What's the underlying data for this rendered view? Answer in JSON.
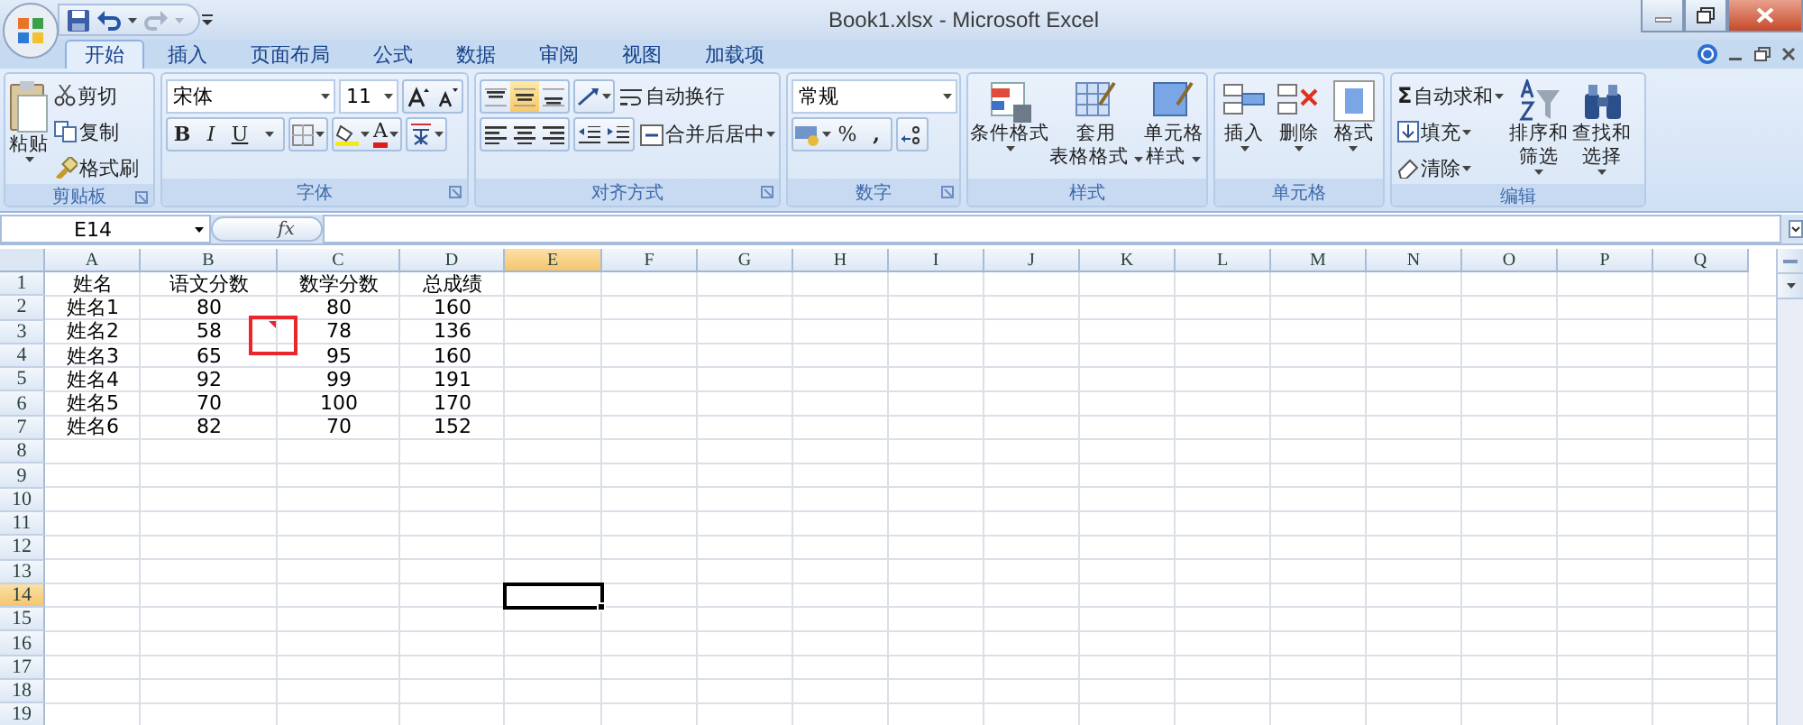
{
  "window": {
    "title": "Book1.xlsx - Microsoft Excel"
  },
  "tabs": [
    {
      "label": "开始",
      "selected": true
    },
    {
      "label": "插入",
      "selected": false
    },
    {
      "label": "页面布局",
      "selected": false
    },
    {
      "label": "公式",
      "selected": false
    },
    {
      "label": "数据",
      "selected": false
    },
    {
      "label": "审阅",
      "selected": false
    },
    {
      "label": "视图",
      "selected": false
    },
    {
      "label": "加载项",
      "selected": false
    }
  ],
  "ribbon": {
    "clipboard": {
      "label": "剪贴板",
      "paste": "粘贴",
      "cut": "剪切",
      "copy": "复制",
      "format_painter": "格式刷"
    },
    "font": {
      "label": "字体",
      "font_name": "宋体",
      "font_size": "11",
      "bold": "B",
      "italic": "I",
      "underline": "U",
      "font_color": "A"
    },
    "alignment": {
      "label": "对齐方式",
      "vertical_align": [
        {
          "selected": false
        },
        {
          "selected": true
        },
        {
          "selected": false
        }
      ],
      "wrap_text": "自动换行",
      "merge_center": "合并后居中"
    },
    "number": {
      "label": "数字",
      "format": "常规",
      "percent": "%",
      "comma": ","
    },
    "styles": {
      "label": "样式",
      "buttons": [
        {
          "lines": [
            "条件格式"
          ],
          "kind": "conditional"
        },
        {
          "lines": [
            "套用",
            "表格格式"
          ],
          "kind": "table"
        },
        {
          "lines": [
            "单元格",
            "样式"
          ],
          "kind": "cellstyle"
        }
      ]
    },
    "cells": {
      "label": "单元格",
      "buttons": [
        {
          "label": "插入",
          "kind": "insert"
        },
        {
          "label": "删除",
          "kind": "delete"
        },
        {
          "label": "格式",
          "kind": "format"
        }
      ]
    },
    "editing": {
      "label": "编辑",
      "sigma": "Σ",
      "autosum": "自动求和",
      "fill": "填充",
      "clear": "清除",
      "sort": [
        "排序和",
        "筛选"
      ],
      "find": [
        "查找和",
        "选择"
      ]
    }
  },
  "formula_bar": {
    "name_box": "E14",
    "function_label": "fx"
  },
  "sheet": {
    "columns": [
      {
        "label": "A",
        "selected": false
      },
      {
        "label": "B",
        "selected": false
      },
      {
        "label": "C",
        "selected": false
      },
      {
        "label": "D",
        "selected": false
      },
      {
        "label": "E",
        "selected": true
      },
      {
        "label": "F",
        "selected": false
      },
      {
        "label": "G",
        "selected": false
      },
      {
        "label": "H",
        "selected": false
      },
      {
        "label": "I",
        "selected": false
      },
      {
        "label": "J",
        "selected": false
      },
      {
        "label": "K",
        "selected": false
      },
      {
        "label": "L",
        "selected": false
      },
      {
        "label": "M",
        "selected": false
      },
      {
        "label": "N",
        "selected": false
      },
      {
        "label": "O",
        "selected": false
      },
      {
        "label": "P",
        "selected": false
      },
      {
        "label": "Q",
        "selected": false
      }
    ],
    "comment_highlight": true,
    "rows": [
      {
        "number": "1",
        "selected": false,
        "cells": [
          {
            "text": "姓名",
            "comment": false
          },
          {
            "text": "语文分数",
            "comment": false
          },
          {
            "text": "数学分数",
            "comment": false
          },
          {
            "text": "总成绩",
            "comment": false
          }
        ]
      },
      {
        "number": "2",
        "selected": false,
        "cells": [
          {
            "text": "姓名1",
            "comment": false
          },
          {
            "text": "80",
            "comment": false
          },
          {
            "text": "80",
            "comment": false
          },
          {
            "text": "160",
            "comment": false
          }
        ]
      },
      {
        "number": "3",
        "selected": false,
        "cells": [
          {
            "text": "姓名2",
            "comment": false
          },
          {
            "text": "58",
            "comment": true
          },
          {
            "text": "78",
            "comment": false
          },
          {
            "text": "136",
            "comment": false
          }
        ]
      },
      {
        "number": "4",
        "selected": false,
        "cells": [
          {
            "text": "姓名3",
            "comment": false
          },
          {
            "text": "65",
            "comment": false
          },
          {
            "text": "95",
            "comment": false
          },
          {
            "text": "160",
            "comment": false
          }
        ]
      },
      {
        "number": "5",
        "selected": false,
        "cells": [
          {
            "text": "姓名4",
            "comment": false
          },
          {
            "text": "92",
            "comment": false
          },
          {
            "text": "99",
            "comment": false
          },
          {
            "text": "191",
            "comment": false
          }
        ]
      },
      {
        "number": "6",
        "selected": false,
        "cells": [
          {
            "text": "姓名5",
            "comment": false
          },
          {
            "text": "70",
            "comment": false
          },
          {
            "text": "100",
            "comment": false
          },
          {
            "text": "170",
            "comment": false
          }
        ]
      },
      {
        "number": "7",
        "selected": false,
        "cells": [
          {
            "text": "姓名6",
            "comment": false
          },
          {
            "text": "82",
            "comment": false
          },
          {
            "text": "70",
            "comment": false
          },
          {
            "text": "152",
            "comment": false
          }
        ]
      },
      {
        "number": "8",
        "selected": false
      },
      {
        "number": "9",
        "selected": false
      },
      {
        "number": "10",
        "selected": false
      },
      {
        "number": "11",
        "selected": false
      },
      {
        "number": "12",
        "selected": false
      },
      {
        "number": "13",
        "selected": false
      },
      {
        "number": "14",
        "selected": true
      },
      {
        "number": "15",
        "selected": false
      },
      {
        "number": "16",
        "selected": false
      },
      {
        "number": "17",
        "selected": false
      },
      {
        "number": "18",
        "selected": false
      },
      {
        "number": "19",
        "selected": false
      }
    ]
  }
}
